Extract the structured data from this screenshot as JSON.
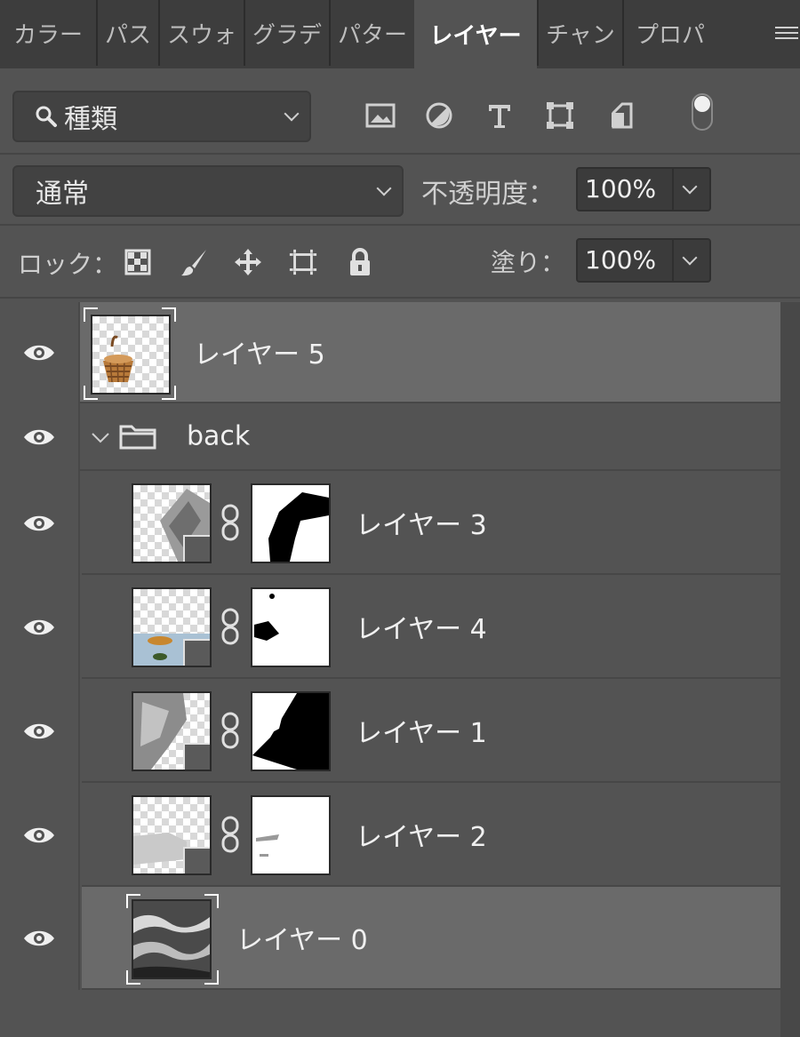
{
  "tabs": [
    {
      "label": "カラー"
    },
    {
      "label": "パス"
    },
    {
      "label": "スウォ"
    },
    {
      "label": "グラデ"
    },
    {
      "label": "パター"
    },
    {
      "label": "レイヤー"
    },
    {
      "label": "チャン"
    },
    {
      "label": "プロパ"
    }
  ],
  "active_tab": "レイヤー",
  "filter": {
    "kind_label": "種類",
    "icons": [
      "image-filter-icon",
      "adjustment-filter-icon",
      "type-filter-icon",
      "shape-filter-icon",
      "smart-object-filter-icon"
    ]
  },
  "blend": {
    "mode": "通常",
    "opacity_label": "不透明度：",
    "opacity_value": "100%"
  },
  "lock": {
    "label": "ロック：",
    "fill_label": "塗り：",
    "fill_value": "100%",
    "icons": [
      "lock-transparent-icon",
      "lock-image-icon",
      "lock-position-icon",
      "lock-artboard-icon",
      "lock-all-icon"
    ]
  },
  "layers": [
    {
      "name": "レイヤー 5",
      "selected": true
    },
    {
      "name": "back",
      "type": "group",
      "expanded": true
    },
    {
      "name": "レイヤー 3"
    },
    {
      "name": "レイヤー 4"
    },
    {
      "name": "レイヤー 1"
    },
    {
      "name": "レイヤー 2"
    },
    {
      "name": "レイヤー 0",
      "selected": true
    }
  ],
  "colors": {
    "panel": "#535353",
    "tabbar": "#3d3d3d",
    "selected": "#6a6a6a"
  }
}
